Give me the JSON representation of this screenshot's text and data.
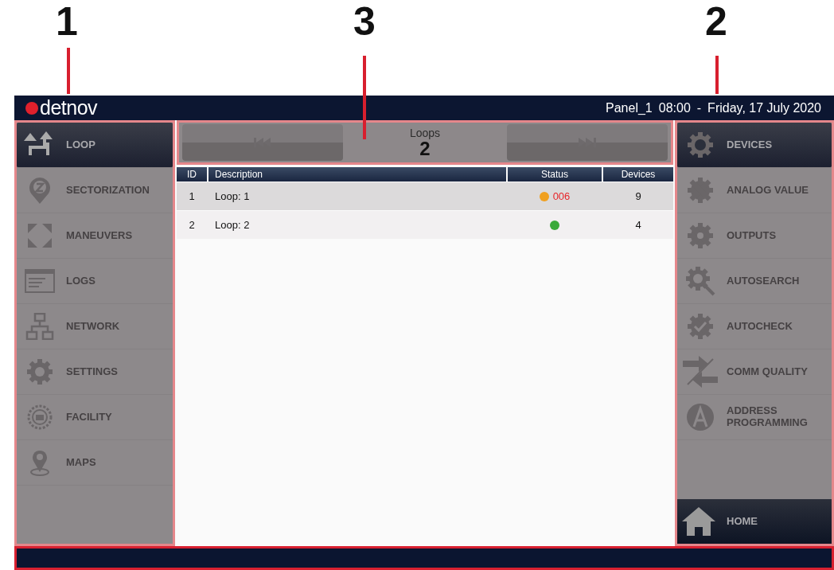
{
  "callouts": [
    {
      "label": "1"
    },
    {
      "label": "3"
    },
    {
      "label": "2"
    }
  ],
  "header": {
    "logo": "detnov",
    "panel": "Panel_1",
    "time": "08:00",
    "separator": "-",
    "date": "Friday, 17 July 2020"
  },
  "left_menu": [
    {
      "label": "LOOP",
      "selected": true
    },
    {
      "label": "SECTORIZATION",
      "selected": false
    },
    {
      "label": "MANEUVERS",
      "selected": false
    },
    {
      "label": "LOGS",
      "selected": false
    },
    {
      "label": "NETWORK",
      "selected": false
    },
    {
      "label": "SETTINGS",
      "selected": false
    },
    {
      "label": "FACILITY",
      "selected": false
    },
    {
      "label": "MAPS",
      "selected": false
    }
  ],
  "navigator": {
    "title": "Loops",
    "value": "2"
  },
  "table": {
    "columns": [
      "ID",
      "Description",
      "Status",
      "Devices"
    ],
    "rows": [
      {
        "id": "1",
        "description": "Loop: 1",
        "status": {
          "kind": "warning",
          "text": "006"
        },
        "devices": "9"
      },
      {
        "id": "2",
        "description": "Loop: 2",
        "status": {
          "kind": "ok"
        },
        "devices": "4"
      }
    ]
  },
  "right_menu": [
    {
      "label": "DEVICES",
      "selected": true
    },
    {
      "label": "ANALOG VALUE",
      "selected": false
    },
    {
      "label": "OUTPUTS",
      "selected": false
    },
    {
      "label": "AUTOSEARCH",
      "selected": false
    },
    {
      "label": "AUTOCHECK",
      "selected": false
    },
    {
      "label": "COMM QUALITY",
      "selected": false
    },
    {
      "label": "ADDRESS PROGRAMMING",
      "selected": false
    }
  ],
  "home": {
    "label": "HOME"
  }
}
